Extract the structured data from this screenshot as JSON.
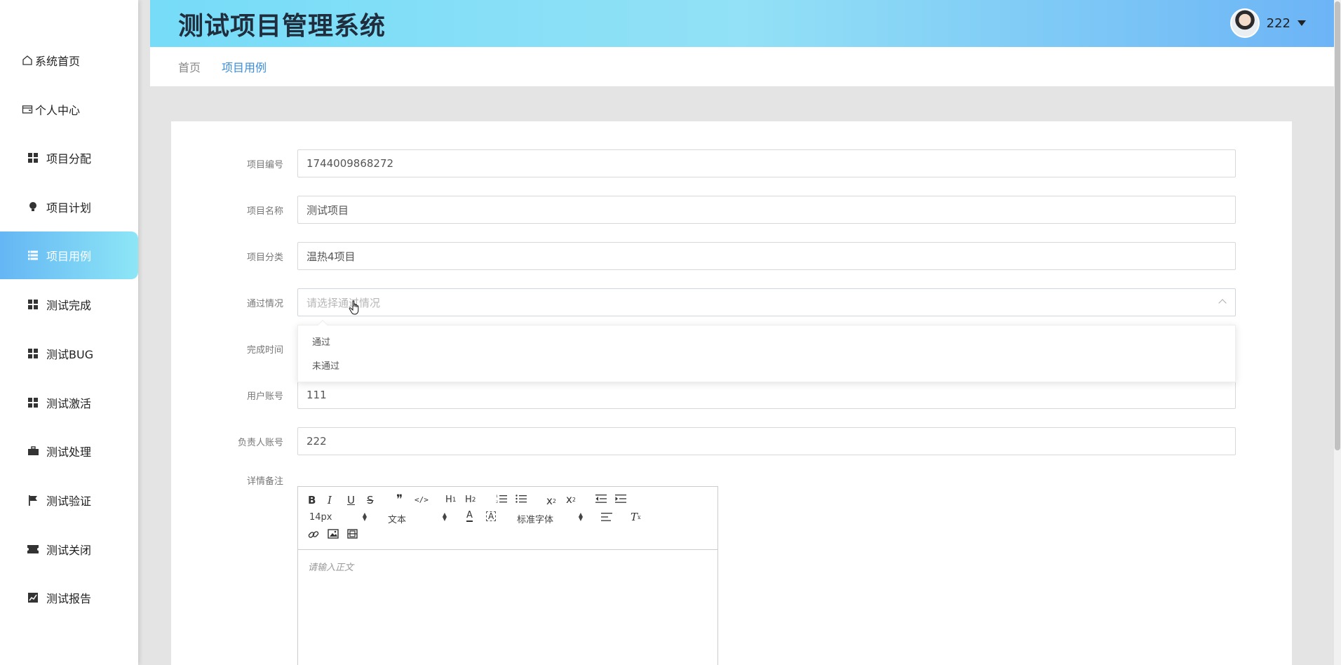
{
  "app": {
    "title": "测试项目管理系统",
    "user": "222"
  },
  "sidebar": {
    "items": [
      {
        "label": "系统首页",
        "icon": "home-icon"
      },
      {
        "label": "个人中心",
        "icon": "wallet-icon"
      },
      {
        "label": "项目分配",
        "icon": "grid-icon"
      },
      {
        "label": "项目计划",
        "icon": "lightbulb-icon"
      },
      {
        "label": "项目用例",
        "icon": "list-icon",
        "active": true
      },
      {
        "label": "测试完成",
        "icon": "grid-icon"
      },
      {
        "label": "测试BUG",
        "icon": "grid-icon"
      },
      {
        "label": "测试激活",
        "icon": "grid-icon"
      },
      {
        "label": "测试处理",
        "icon": "briefcase-icon"
      },
      {
        "label": "测试验证",
        "icon": "flag-icon"
      },
      {
        "label": "测试关闭",
        "icon": "ticket-icon"
      },
      {
        "label": "测试报告",
        "icon": "chart-icon"
      }
    ]
  },
  "breadcrumb": {
    "home": "首页",
    "current": "项目用例"
  },
  "form": {
    "project_no": {
      "label": "项目编号",
      "value": "1744009868272"
    },
    "project_name": {
      "label": "项目名称",
      "value": "测试项目"
    },
    "project_category": {
      "label": "项目分类",
      "value": "温热4项目"
    },
    "pass_status": {
      "label": "通过情况",
      "placeholder": "请选择通过情况",
      "options": [
        "通过",
        "未通过"
      ]
    },
    "complete_time": {
      "label": "完成时间"
    },
    "user_account": {
      "label": "用户账号",
      "value": "111"
    },
    "owner_account": {
      "label": "负责人账号",
      "value": "222"
    },
    "details": {
      "label": "详情备注",
      "placeholder": "请输入正文"
    }
  },
  "editor": {
    "buttons": [
      "B",
      "I",
      "U",
      "S",
      "❞",
      "</>",
      "H1",
      "H2",
      "ol",
      "ul",
      "x₂",
      "x²",
      "outdent",
      "indent"
    ],
    "font_size": "14px",
    "header_select": "文本",
    "font_family": "标准字体"
  },
  "colors": {
    "accent": "#3a8dd8",
    "header_start": "#76dcf8",
    "header_end": "#6cb4f6"
  }
}
